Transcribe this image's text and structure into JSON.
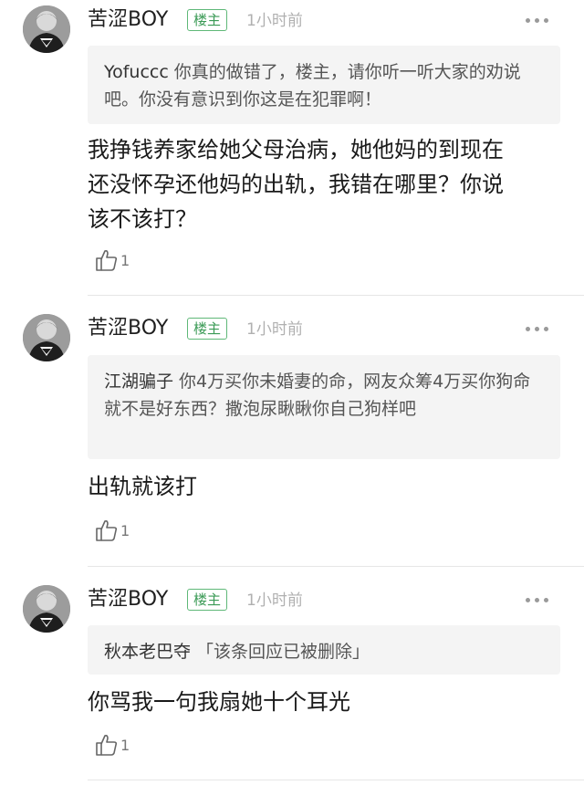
{
  "comments": [
    {
      "username": "苦涩BOY",
      "badge": "楼主",
      "time": "1小时前",
      "quote_author": "Yofuccc",
      "quote_text": "你真的做错了，楼主，请你听一听大家的劝说吧。你没有意识到你这是在犯罪啊！",
      "reply_lines": [
        "我挣钱养家给她父母治病，她他妈的到现在",
        "还没怀孕还他妈的出轨，我错在哪里？你说",
        "该不该打？"
      ],
      "likes": "1",
      "more_icon": "more-dots-icon",
      "like_icon": "thumbs-up-icon"
    },
    {
      "username": "苦涩BOY",
      "badge": "楼主",
      "time": "1小时前",
      "quote_author": "江湖骗子",
      "quote_text": "你4万买你未婚妻的命，网友众筹4万买你狗命就不是好东西？撒泡尿瞅瞅你自己狗样吧",
      "reply_lines": [
        "出轨就该打"
      ],
      "likes": "1",
      "more_icon": "more-dots-icon",
      "like_icon": "thumbs-up-icon"
    },
    {
      "username": "苦涩BOY",
      "badge": "楼主",
      "time": "1小时前",
      "quote_author": "秋本老巴夺",
      "quote_text": "「该条回应已被删除」",
      "reply_lines": [
        "你骂我一句我扇她十个耳光"
      ],
      "likes": "1",
      "more_icon": "more-dots-icon",
      "like_icon": "thumbs-up-icon"
    }
  ],
  "colors": {
    "badge_green": "#3a9a55",
    "quote_background": "#f4f4f4",
    "time_gray": "#b0b0b0"
  }
}
